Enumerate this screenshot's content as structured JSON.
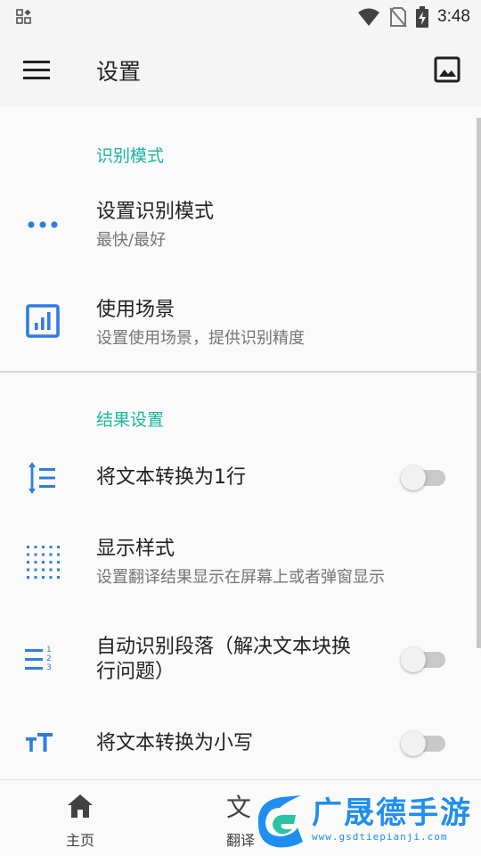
{
  "status_bar": {
    "time": "3:48"
  },
  "app_bar": {
    "title": "设置"
  },
  "sections": {
    "recognition": {
      "header": "识别模式",
      "items": [
        {
          "title": "设置识别模式",
          "subtitle": "最快/最好",
          "icon": "more-horiz-icon"
        },
        {
          "title": "使用场景",
          "subtitle": "设置使用场景，提供识别精度",
          "icon": "bar-chart-icon"
        }
      ]
    },
    "results": {
      "header": "结果设置",
      "items": [
        {
          "title": "将文本转换为1行",
          "icon": "line-height-icon",
          "switch_on": false
        },
        {
          "title": "显示样式",
          "subtitle": "设置翻译结果显示在屏幕上或者弹窗显示",
          "icon": "dot-grid-icon"
        },
        {
          "title": "自动识别段落（解决文本块换",
          "title_line2": "行问题）",
          "icon": "numbered-list-icon",
          "switch_on": false
        },
        {
          "title": "将文本转换为小写",
          "icon": "text-size-icon",
          "switch_on": false
        }
      ]
    }
  },
  "bottom_nav": {
    "items": [
      {
        "label": "主页",
        "icon": "home-icon"
      },
      {
        "label": "翻译",
        "icon": "translate-icon"
      }
    ]
  },
  "watermark": {
    "text": "广晟德手游",
    "url": "www.gsdtiepianji.com"
  },
  "colors": {
    "accent": "#1ab6a4",
    "icon_blue": "#2f7de1",
    "watermark_blue": "#1f8ef1"
  }
}
